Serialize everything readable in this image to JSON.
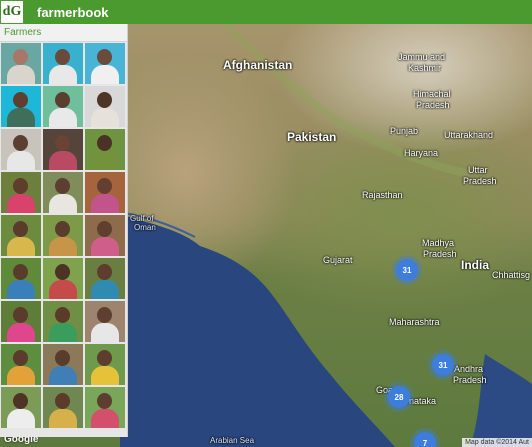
{
  "header": {
    "logo_text": "dG",
    "app_name": "farmerbook",
    "color": "#4b9a2f"
  },
  "panel": {
    "title": "Farmers",
    "thumbs": [
      {
        "bg": "#6aa6a2",
        "skin": "#a7786a",
        "cloth": "#d9d5cd"
      },
      {
        "bg": "#3ab0cf",
        "skin": "#6a4a3a",
        "cloth": "#e8e8e8"
      },
      {
        "bg": "#49b4d6",
        "skin": "#6b4b3c",
        "cloth": "#f0f0f0"
      },
      {
        "bg": "#1fb7d8",
        "skin": "#5d4030",
        "cloth": "#3f6e5a"
      },
      {
        "bg": "#6fbf9d",
        "skin": "#5a3e2f",
        "cloth": "#e9e9e9"
      },
      {
        "bg": "#d8d8d8",
        "skin": "#4e3526",
        "cloth": "#e6e2d9"
      },
      {
        "bg": "#c9c4bb",
        "skin": "#5b4032",
        "cloth": "#e7e7e7"
      },
      {
        "bg": "#55443a",
        "skin": "#6a4333",
        "cloth": "#b84a63"
      },
      {
        "bg": "#6e9440",
        "skin": "#4a3326",
        "cloth": "#73923b"
      },
      {
        "bg": "#6c7f3c",
        "skin": "#5e3d2c",
        "cloth": "#d9426b"
      },
      {
        "bg": "#7e8d5a",
        "skin": "#5c3f31",
        "cloth": "#e8e6df"
      },
      {
        "bg": "#a5643d",
        "skin": "#643f30",
        "cloth": "#c3548b"
      },
      {
        "bg": "#6d8b3f",
        "skin": "#5a3c2c",
        "cloth": "#d8b74d"
      },
      {
        "bg": "#7d9a48",
        "skin": "#5b3d2c",
        "cloth": "#c89447"
      },
      {
        "bg": "#8e6b4a",
        "skin": "#5f3f2f",
        "cloth": "#cf5f8a"
      },
      {
        "bg": "#5f8a3a",
        "skin": "#5a3c2b",
        "cloth": "#3a80b8"
      },
      {
        "bg": "#7fa24c",
        "skin": "#4d3326",
        "cloth": "#c54a4a"
      },
      {
        "bg": "#6b7e42",
        "skin": "#5d3d2c",
        "cloth": "#2f8bb1"
      },
      {
        "bg": "#5e7d39",
        "skin": "#5b3b2b",
        "cloth": "#e0468d"
      },
      {
        "bg": "#6f8f47",
        "skin": "#5a3b2a",
        "cloth": "#3a9d5c"
      },
      {
        "bg": "#9d846e",
        "skin": "#5f4030",
        "cloth": "#e7e7e7"
      },
      {
        "bg": "#5d8d3e",
        "skin": "#5b3b2b",
        "cloth": "#e3a13a"
      },
      {
        "bg": "#8a7a5a",
        "skin": "#5a3c2d",
        "cloth": "#3f7fb5"
      },
      {
        "bg": "#6f9a4c",
        "skin": "#5c3e2e",
        "cloth": "#e6c23b"
      },
      {
        "bg": "#7c9b57",
        "skin": "#4f3426",
        "cloth": "#ededed"
      },
      {
        "bg": "#6f8750",
        "skin": "#5b3c2b",
        "cloth": "#d6b04a"
      },
      {
        "bg": "#79a658",
        "skin": "#5e3f2f",
        "cloth": "#d44f6b"
      }
    ]
  },
  "map": {
    "labels": {
      "afghanistan": "Afghanistan",
      "pakistan": "Pakistan",
      "india": "India",
      "jammu": "Jammu and",
      "kashmir": "Kashmir",
      "himachal": "Himachal",
      "pradesh_h": "Pradesh",
      "punjab": "Punjab",
      "uttarakhand": "Uttarakhand",
      "haryana": "Haryana",
      "uttar": "Uttar",
      "pradesh_u": "Pradesh",
      "rajasthan": "Rajasthan",
      "gulf": "Gulf of",
      "oman": "Oman",
      "gujarat": "Gujarat",
      "madhya": "Madhya",
      "pradesh_m": "Pradesh",
      "chhattisgarh": "Chhattisg",
      "maharashtra": "Maharashtra",
      "andhra": "Andhra",
      "pradesh_a": "Pradesh",
      "goa": "Goa",
      "karnataka": "rnataka",
      "arabian_sea": "Arabian Sea"
    },
    "clusters": [
      {
        "count": "31"
      },
      {
        "count": "31"
      },
      {
        "count": "28"
      },
      {
        "count": "7"
      }
    ],
    "google": "Google",
    "attribution": "Map data ©2014 Aut"
  }
}
